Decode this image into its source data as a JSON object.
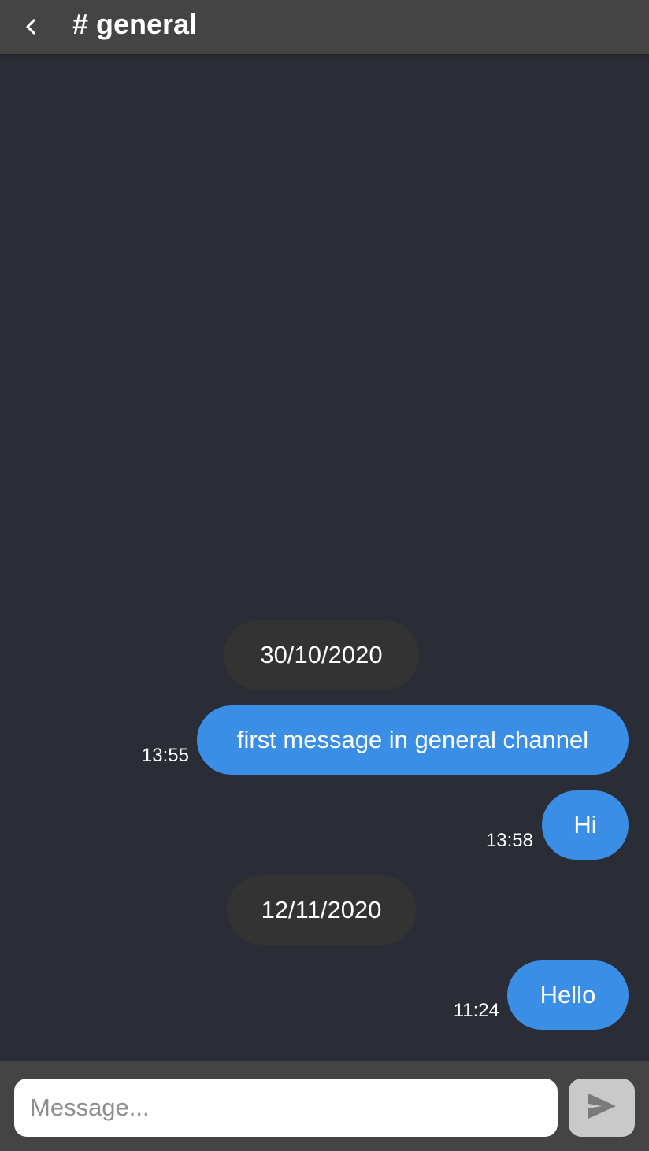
{
  "header": {
    "channel_name": "# general",
    "back_icon": "chevron-left-icon"
  },
  "messages": [
    {
      "type": "date",
      "label": "30/10/2020"
    },
    {
      "type": "message",
      "text": "first message in general channel",
      "time": "13:55"
    },
    {
      "type": "message",
      "text": "Hi",
      "time": "13:58"
    },
    {
      "type": "date",
      "label": "12/11/2020"
    },
    {
      "type": "message",
      "text": "Hello",
      "time": "11:24"
    }
  ],
  "composer": {
    "placeholder": "Message...",
    "value": "",
    "send_icon": "send-icon"
  },
  "colors": {
    "background": "#2a2d35",
    "header": "#444444",
    "bubble": "#3a8ee6",
    "date_pill": "#333333",
    "send_button": "#c9c9c9"
  }
}
